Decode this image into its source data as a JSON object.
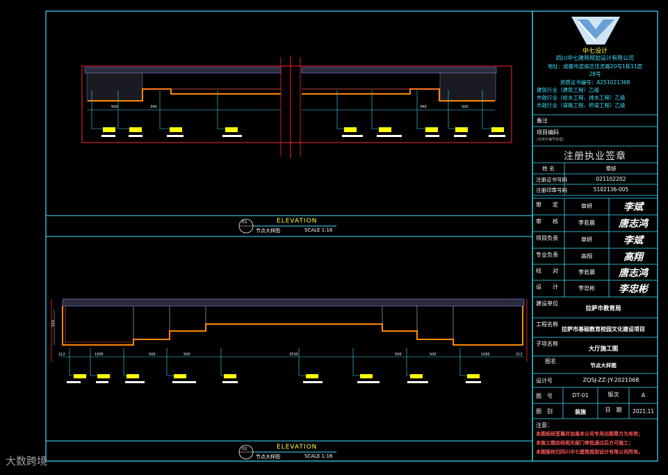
{
  "company": {
    "name": "中七设计",
    "full_name": "四川中七建筑规划设计有限公司",
    "address_line1": "地址：成都市武侯区佳灵路20号1栋11层",
    "address_line2": "28号",
    "cert_line": "资质证书编号：A251021368",
    "qual1": "建筑行业（建筑工程）乙级",
    "qual2": "市政行业（给水工程、排水工程）乙级",
    "qual3": "市政行业（道路工程、桥梁工程）乙级"
  },
  "remarks_label": "备注",
  "project_code_label": "项目编码",
  "project_code_note": "(仅用于编号管理)",
  "registration": {
    "title": "注册执业签章",
    "name_label": "姓 名",
    "name_value": "章妍",
    "cert_label": "注册证书号码",
    "cert_value": "021102202",
    "seal_label": "注册印章号码",
    "seal_value": "5102136-005"
  },
  "signoffs": [
    {
      "role": "审　　定",
      "name": "章妍",
      "sig": "李斌"
    },
    {
      "role": "审　　核",
      "name": "李若晨",
      "sig": "唐志鸿"
    },
    {
      "role": "项目负责",
      "name": "章妍",
      "sig": "李斌"
    },
    {
      "role": "专业负责",
      "name": "高翔",
      "sig": "高翔"
    },
    {
      "role": "校　　对",
      "name": "李若晨",
      "sig": "唐志鸿"
    },
    {
      "role": "设　　计",
      "name": "李忠彬",
      "sig": "李忠彬"
    }
  ],
  "client_label": "建设单位",
  "client_value": "拉萨市教育局",
  "project_label": "工程名称",
  "project_value": "拉萨市基础教育校园文化建设项目",
  "subproject_label": "子项名称",
  "subproject_value": "大厅施工图",
  "drawing_name_label": "图名",
  "drawing_name_value": "节点大样图",
  "design_no_label": "设计号",
  "design_no_value": "ZQSJ-ZZ-JY-2021068",
  "sheet_no_label": "图　号",
  "sheet_no_value": "DT-01",
  "version_label": "版次",
  "version_value": "A",
  "type_label": "图　别",
  "type_value": "装施",
  "date_label": "日　期",
  "date_value": "2021.11",
  "notes_label": "注意：",
  "notes": [
    "本图纸经签署并加盖本公司专用出图章方为有效；",
    "本施工图应经相关部门审批通过后方可施工；",
    "本图版权归四川中七建筑规划设计有限公司所有。"
  ],
  "elevation1": {
    "num": "01",
    "label": "ELEVATION",
    "sub": "节点大样图",
    "scale": "SCALE 1:16",
    "dims": [
      "500",
      "340",
      "340",
      "500"
    ]
  },
  "elevation2": {
    "num": "02",
    "label": "ELEVATION",
    "sub": "节点大样图",
    "scale": "SCALE 1:16",
    "dims": [
      "212",
      "1095",
      "500",
      "500",
      "2530",
      "500",
      "500",
      "1095",
      "212"
    ],
    "height": "550"
  },
  "watermark": "大数跨境"
}
